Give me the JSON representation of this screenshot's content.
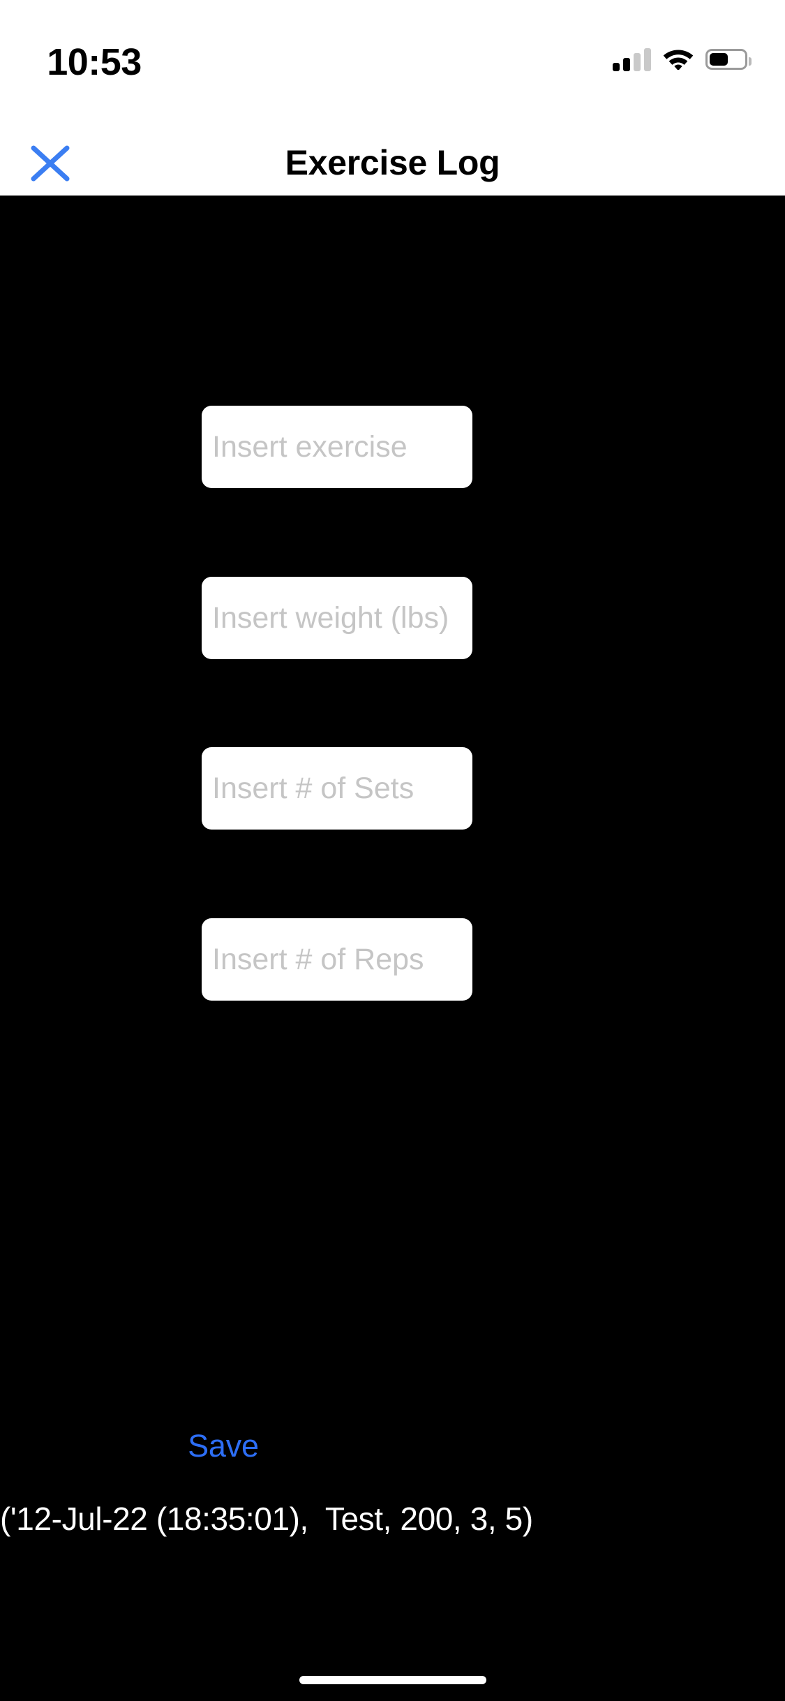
{
  "status_bar": {
    "time": "10:53",
    "icons": {
      "cellular": "cellular-signal-icon",
      "wifi": "wifi-icon",
      "battery": "battery-icon"
    },
    "signal_bars_filled": 2,
    "signal_bars_total": 4,
    "battery_level_percent": 50
  },
  "nav_bar": {
    "close_icon": "close-icon",
    "title": "Exercise Log",
    "accent_color": "#3b7ef2"
  },
  "form": {
    "fields": [
      {
        "name": "exercise",
        "value": "",
        "placeholder": "Insert exercise"
      },
      {
        "name": "weight",
        "value": "",
        "placeholder": "Insert weight (lbs)"
      },
      {
        "name": "sets",
        "value": "",
        "placeholder": "Insert # of Sets"
      },
      {
        "name": "reps",
        "value": "",
        "placeholder": "Insert # of Reps"
      }
    ],
    "save_label": "Save",
    "save_color": "#2d6ef5"
  },
  "log": {
    "entries": [
      "('12-Jul-22 (18:35:01),  Test, 200, 3, 5)"
    ]
  },
  "theme": {
    "background": "#000000",
    "header_background": "#ffffff",
    "field_background": "#ffffff",
    "placeholder_color": "#c5c5c5",
    "log_text_color": "#ffffff"
  }
}
